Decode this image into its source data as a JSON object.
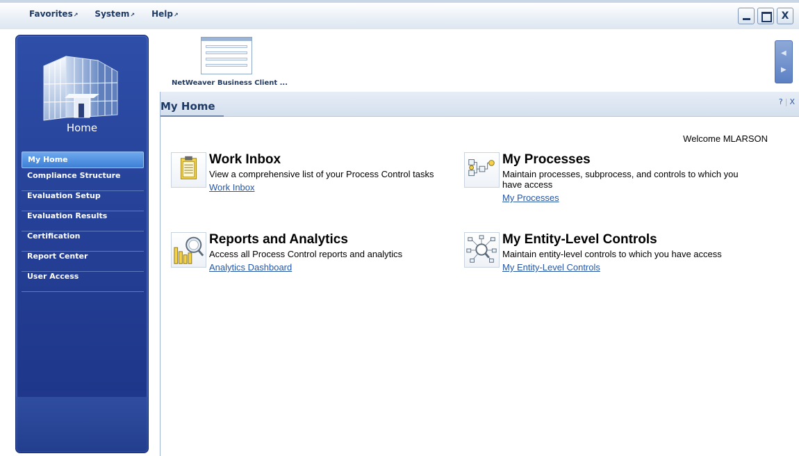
{
  "menu": {
    "items": [
      "Favorites",
      "System",
      "Help"
    ]
  },
  "window": {
    "close_label": "X"
  },
  "sidebar": {
    "title": "Home",
    "nav": [
      {
        "label": "My Home",
        "active": true
      },
      {
        "label": "Compliance Structure",
        "active": false
      },
      {
        "label": "Evaluation Setup",
        "active": false
      },
      {
        "label": "Evaluation Results",
        "active": false
      },
      {
        "label": "Certification",
        "active": false
      },
      {
        "label": "Report Center",
        "active": false
      },
      {
        "label": "User Access",
        "active": false
      }
    ]
  },
  "launcher": {
    "item_label": "NetWeaver Business Client ..."
  },
  "panel": {
    "title": "My Home",
    "help": "?",
    "close": "X",
    "welcome": "Welcome MLARSON"
  },
  "tiles": [
    {
      "title": "Work Inbox",
      "description": "View a comprehensive list of your Process Control tasks",
      "link": "Work Inbox",
      "icon": "clipboard-icon"
    },
    {
      "title": "My Processes",
      "description": "Maintain processes, subprocess, and controls to which you have access",
      "link": "My Processes",
      "icon": "process-flow-icon"
    },
    {
      "title": "Reports and Analytics",
      "description": "Access all Process Control reports and analytics",
      "link": "Analytics Dashboard",
      "icon": "report-chart-icon"
    },
    {
      "title": "My Entity-Level Controls",
      "description": "Maintain entity-level controls to which you have access",
      "link": "My Entity-Level Controls",
      "icon": "entity-network-icon"
    }
  ],
  "colors": {
    "sidebar": "#243f95",
    "active_nav": "#4d8fe0",
    "link": "#2455a6",
    "header_text": "#1e3a64"
  }
}
